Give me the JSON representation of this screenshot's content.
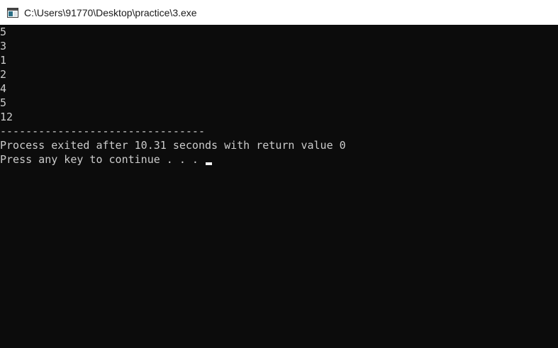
{
  "window": {
    "title": "C:\\Users\\91770\\Desktop\\practice\\3.exe",
    "icon": "console-window-icon"
  },
  "console": {
    "lines": [
      "5",
      "3",
      "1",
      "2",
      "4",
      "5",
      "12",
      "--------------------------------",
      "Process exited after 10.31 seconds with return value 0",
      "Press any key to continue . . . "
    ]
  },
  "colors": {
    "background": "#0c0c0c",
    "text": "#cccccc",
    "titlebar": "#ffffff"
  }
}
